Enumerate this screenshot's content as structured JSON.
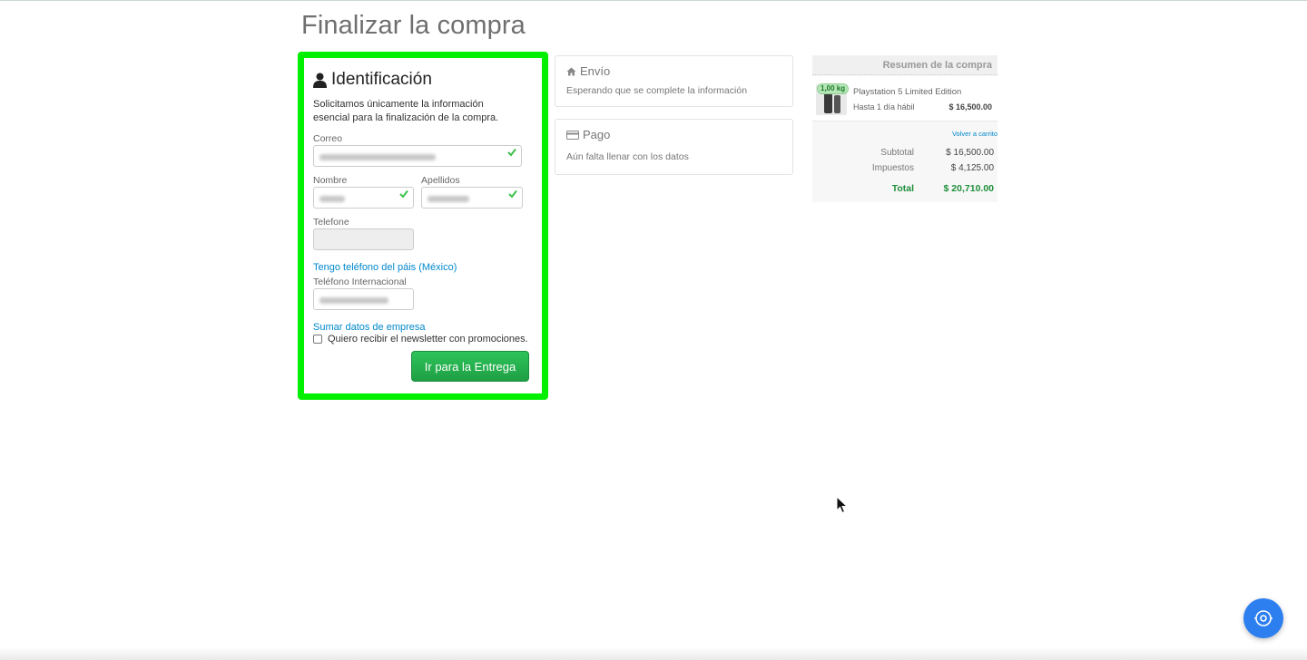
{
  "page": {
    "title": "Finalizar la compra"
  },
  "identification": {
    "heading": "Identificación",
    "description": "Solicitamos únicamente la información esencial para la finalización de la compra.",
    "email_label": "Correo",
    "name_label": "Nombre",
    "surname_label": "Apellidos",
    "phone_label": "Telefone",
    "country_phone_link": "Tengo teléfono del páis (México)",
    "intl_phone_label": "Teléfono Internacional",
    "company_link": "Sumar datos de empresa",
    "newsletter_label": "Quiero recibir el newsletter con promociones.",
    "newsletter_checked": false,
    "submit_label": "Ir para la Entrega",
    "highlight_color": "#00f000",
    "button_color": "#28b04f"
  },
  "shipping": {
    "heading": "Envío",
    "status": "Esperando que se complete la información"
  },
  "payment": {
    "heading": "Pago",
    "status": "Aún falta llenar con los datos"
  },
  "summary": {
    "heading": "Resumen de la compra",
    "item": {
      "weight": "1,00 kg",
      "name": "Playstation 5 Limited Edition",
      "delivery": "Hasta 1 día hábil",
      "price": "$ 16,500.00"
    },
    "back_to_cart": "Volver a carrito",
    "subtotal_label": "Subtotal",
    "subtotal_value": "$ 16,500.00",
    "tax_label": "Impuestos",
    "tax_value": "$ 4,125.00",
    "total_label": "Total",
    "total_value": "$ 20,710.00",
    "total_color": "#1f8f3a"
  },
  "fab": {
    "icon": "target-icon",
    "color": "#2d7ff0"
  }
}
